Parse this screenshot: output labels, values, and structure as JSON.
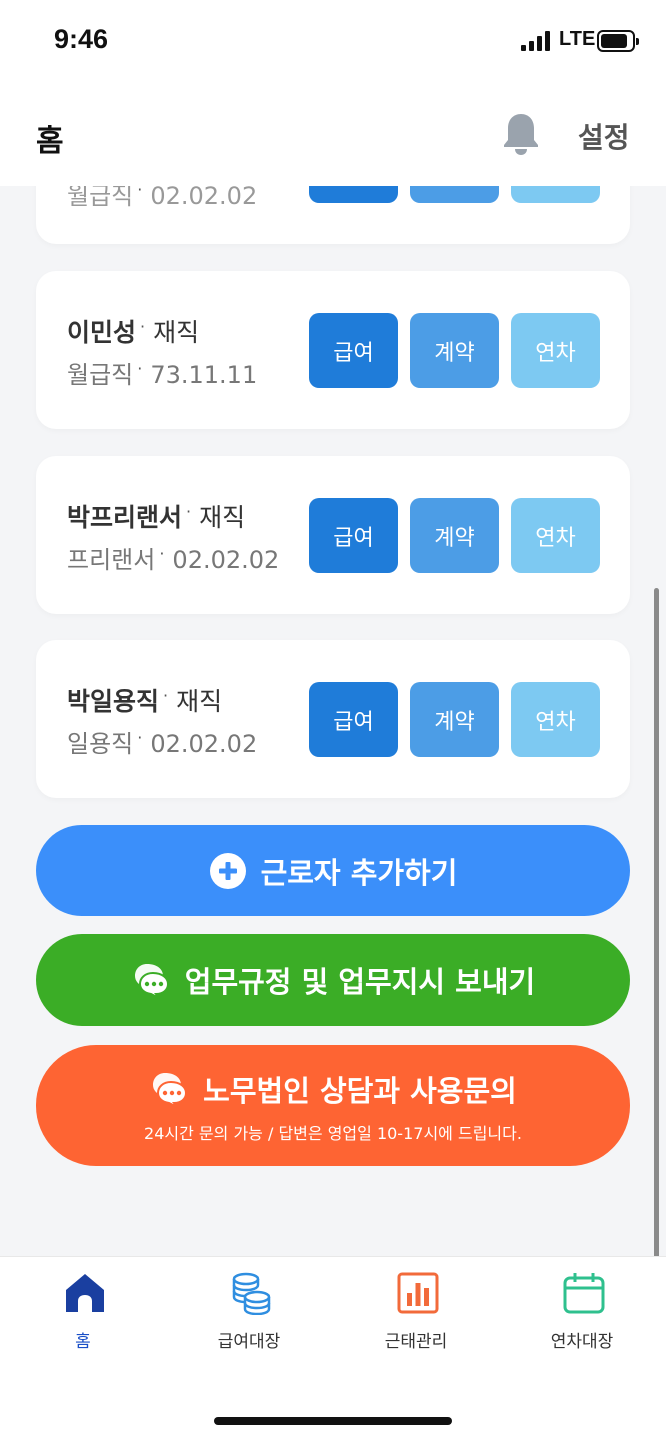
{
  "status_bar": {
    "time": "9:46",
    "network": "LTE"
  },
  "header": {
    "title": "홈",
    "settings_label": "설정",
    "bell_icon": "bell-icon"
  },
  "partial_card": {
    "sub_type": "월급직",
    "sub_date": "02.02.02"
  },
  "workers": [
    {
      "name": "이민성",
      "status": "재직",
      "type": "월급직",
      "date": "73.11.11"
    },
    {
      "name": "박프리랜서",
      "status": "재직",
      "type": "프리랜서",
      "date": "02.02.02"
    },
    {
      "name": "박일용직",
      "status": "재직",
      "type": "일용직",
      "date": "02.02.02"
    }
  ],
  "card_buttons": {
    "pay": "급여",
    "contract": "계약",
    "leave": "연차"
  },
  "actions": {
    "add_worker": "근로자 추가하기",
    "send_rules": "업무규정 및 업무지시 보내기",
    "consult_title": "노무법인 상담과 사용문의",
    "consult_sub": "24시간 문의 가능 / 답변은 영업일 10-17시에 드립니다."
  },
  "bottom_nav": [
    {
      "label": "홈",
      "icon": "home-icon",
      "active": true
    },
    {
      "label": "급여대장",
      "icon": "coins-icon",
      "active": false
    },
    {
      "label": "근태관리",
      "icon": "bar-chart-icon",
      "active": false
    },
    {
      "label": "연차대장",
      "icon": "calendar-icon",
      "active": false
    }
  ],
  "colors": {
    "pay_button": "#1f7cd9",
    "contract_button": "#4c9de6",
    "leave_button": "#7dc9f2",
    "add_worker": "#3b8ffa",
    "send_rules": "#3bad26",
    "consult": "#fe6433",
    "nav_active": "#1a4fc7"
  }
}
